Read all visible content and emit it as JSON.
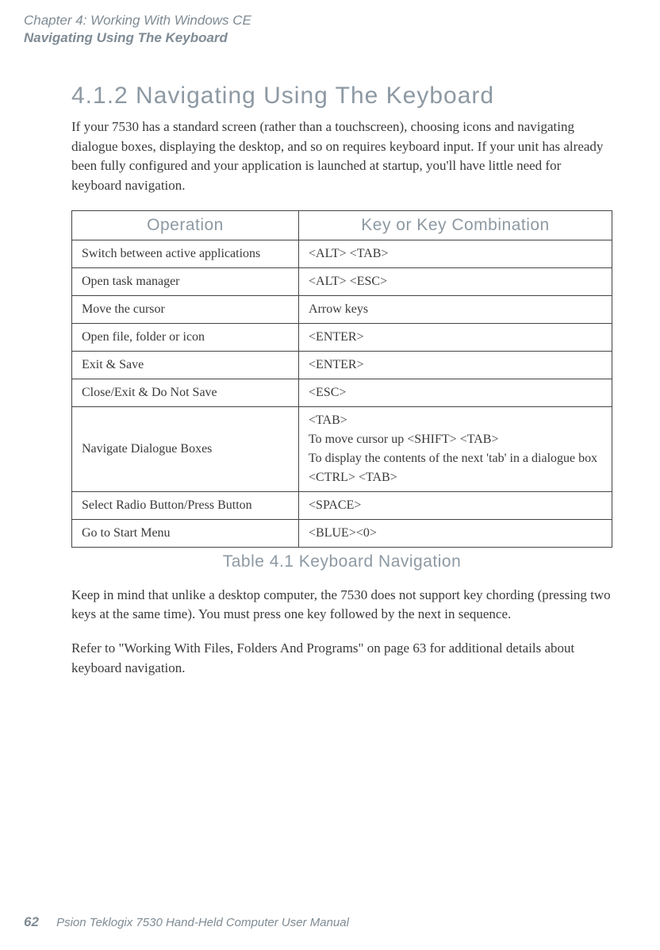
{
  "header": {
    "chapter": "Chapter 4: Working With Windows CE",
    "section": "Navigating Using The Keyboard"
  },
  "heading": "4.1.2  Navigating Using The Keyboard",
  "intro": "If your 7530 has a standard screen (rather than a touchscreen), choosing icons and navigating dialogue boxes, displaying the desktop, and so on requires keyboard input. If your unit has already been fully configured and your application is launched at startup, you'll have little need for keyboard navigation.",
  "table": {
    "headers": {
      "operation": "Operation",
      "key": "Key or Key Combination"
    },
    "rows": [
      {
        "op": "Switch between active applications",
        "key": "<ALT> <TAB>"
      },
      {
        "op": "Open task manager",
        "key": "<ALT> <ESC>"
      },
      {
        "op": "Move the cursor",
        "key": "Arrow keys"
      },
      {
        "op": "Open file, folder or icon",
        "key": "<ENTER>"
      },
      {
        "op": "Exit & Save",
        "key": "<ENTER>"
      },
      {
        "op": "Close/Exit & Do Not Save",
        "key": "<ESC>"
      },
      {
        "op": "Navigate Dialogue Boxes",
        "key": "<TAB>\nTo move cursor up <SHIFT> <TAB>\nTo display the contents of the next 'tab' in a dialogue box <CTRL> <TAB>"
      },
      {
        "op": "Select Radio Button/Press Button",
        "key": "<SPACE>"
      },
      {
        "op": "Go to Start Menu",
        "key": "<BLUE><0>"
      }
    ],
    "caption": "Table 4.1  Keyboard Navigation"
  },
  "after_table_p1": "Keep in mind that unlike a desktop computer, the 7530 does not support key chording (pressing two keys at the same time). You must press one key followed by the next in sequence.",
  "after_table_p2": "Refer to \"Working With Files, Folders And Programs\" on page 63 for additional details about keyboard navigation.",
  "footer": {
    "page": "62",
    "title": "Psion Teklogix 7530 Hand-Held Computer User Manual"
  }
}
